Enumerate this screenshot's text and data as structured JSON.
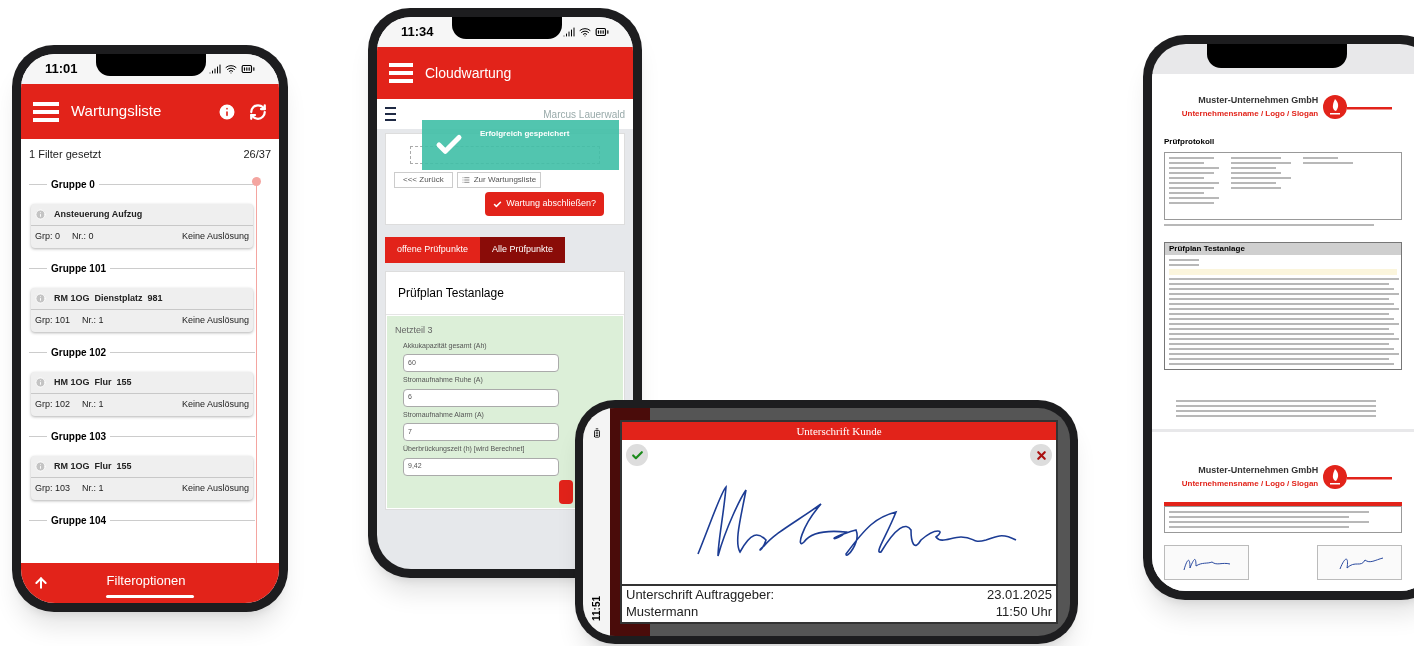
{
  "list_screen": {
    "time": "11:01",
    "title": "Wartungsliste",
    "filter_status": "1 Filter gesetzt",
    "count": "26/37",
    "groups": [
      {
        "heading": "Gruppe 0",
        "items": [
          {
            "name": "Ansteuerung Aufzug",
            "group": "Grp: 0",
            "number": "Nr.: 0",
            "trigger": "Keine Auslösung"
          }
        ]
      },
      {
        "heading": "Gruppe 101",
        "items": [
          {
            "name": "RM 1OG  Dienstplatz  981",
            "group": "Grp: 101",
            "number": "Nr.: 1",
            "trigger": "Keine Auslösung"
          }
        ]
      },
      {
        "heading": "Gruppe 102",
        "items": [
          {
            "name": "HM 1OG  Flur  155",
            "group": "Grp: 102",
            "number": "Nr.: 1",
            "trigger": "Keine Auslösung"
          }
        ]
      },
      {
        "heading": "Gruppe 103",
        "items": [
          {
            "name": "RM 1OG  Flur  155",
            "group": "Grp: 103",
            "number": "Nr.: 1",
            "trigger": "Keine Auslösung"
          }
        ]
      },
      {
        "heading": "Gruppe 104"
      }
    ],
    "bottom_bar": {
      "label": "Filteroptionen"
    }
  },
  "form_screen": {
    "time": "11:34",
    "title": "Cloudwartung",
    "user": "Marcus Lauerwald",
    "toast": "Erfolgreich gespeichert",
    "back_button": "<<< Zurück",
    "list_button": "Zur Wartungsliste",
    "finish_button": "Wartung abschließen?",
    "tabs": [
      {
        "label": "offene Prüfpunkte",
        "selected": false
      },
      {
        "label": "Alle Prüfpunkte",
        "selected": true
      }
    ],
    "plan_title": "Prüfplan Testanlage",
    "section": "Netzteil 3",
    "fields": [
      {
        "label": "Akkukapazität gesamt (Ah)",
        "value": "60"
      },
      {
        "label": "Stromaufnahme Ruhe (A)",
        "value": "6"
      },
      {
        "label": "Stromaufnahme Alarm (A)",
        "value": "7"
      },
      {
        "label": "Überbrückungszeit (h) [wird Berechnet]",
        "value": "9,42"
      }
    ]
  },
  "signature_screen": {
    "time": "11:51",
    "title": "Unterschrift Kunde",
    "signer_label": "Unterschrift Auftraggeber:",
    "signer_name": "Mustermann",
    "date": "23.01.2025",
    "signed_time": "11:50 Uhr"
  },
  "report_screen": {
    "pages": [
      {
        "company": "Muster-Unternehmen GmbH",
        "slogan": "Unternehmensname / Logo / Slogan",
        "heading": "Prüfprotokoll",
        "table_title": "Prüfplan Testanlage"
      },
      {
        "company": "Muster-Unternehmen GmbH",
        "slogan": "Unternehmensname / Logo / Slogan"
      }
    ]
  }
}
